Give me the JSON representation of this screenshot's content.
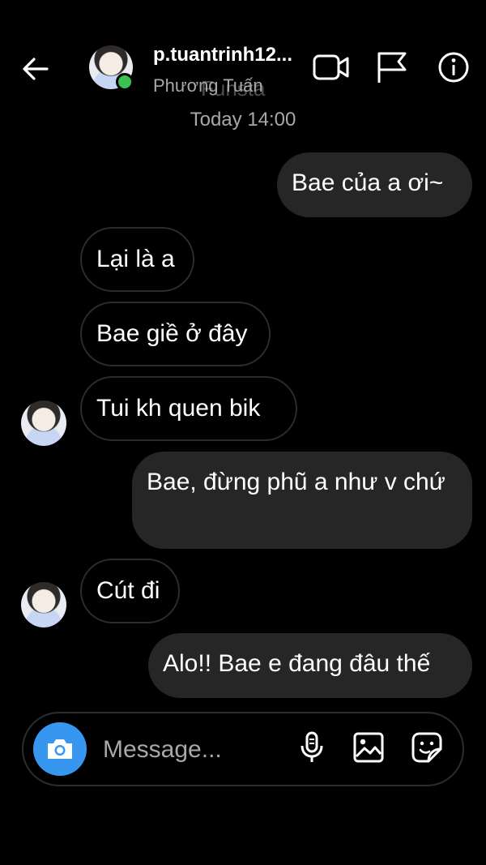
{
  "header": {
    "username": "p.tuantrinh12...",
    "full_name": "Phương Tuấn",
    "watermark": "Funsta",
    "icons": [
      "back-arrow-icon",
      "video-call-icon",
      "flag-icon",
      "info-icon"
    ],
    "online_color": "#39c24f"
  },
  "timestamp": "Today 14:00",
  "messages": [
    {
      "side": "sent",
      "text": "Bae của a ơi~"
    },
    {
      "side": "received",
      "text": "Lại là a"
    },
    {
      "side": "received",
      "text": "Bae giề ở đây"
    },
    {
      "side": "received",
      "text": "Tui kh quen bik"
    },
    {
      "side": "sent",
      "text": "Bae, đừng phũ a như v chứ"
    },
    {
      "side": "received",
      "text": "Cút đi"
    },
    {
      "side": "sent",
      "text": "Alo!! Bae e đang đâu thế"
    }
  ],
  "composer": {
    "placeholder": "Message...",
    "accent_color": "#3797f0",
    "icons": [
      "camera-icon",
      "microphone-icon",
      "gallery-icon",
      "sticker-icon"
    ]
  }
}
